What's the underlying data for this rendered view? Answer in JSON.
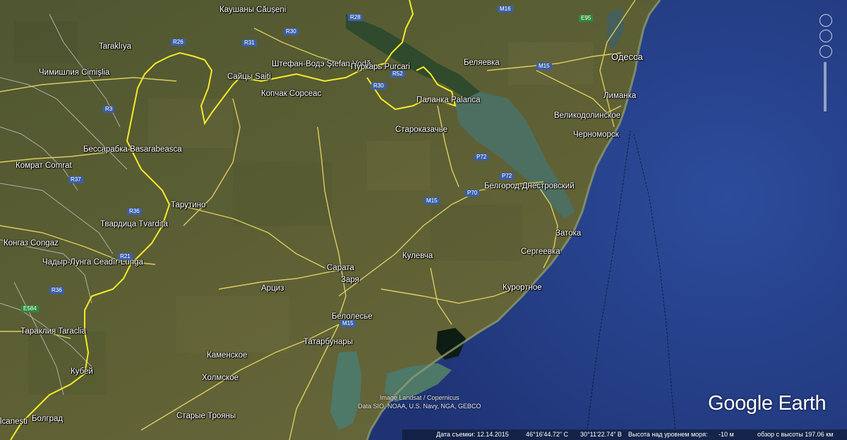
{
  "places": [
    {
      "name": "Каушаны Căușeni",
      "kind": "city"
    },
    {
      "name": "Taraklıya",
      "kind": "city"
    },
    {
      "name": "Чимишлия Cimişlia",
      "kind": "city"
    },
    {
      "name": "Штефан-Водэ Ştefan Vodă",
      "kind": "city"
    },
    {
      "name": "Пуркарь Purcari",
      "kind": "village"
    },
    {
      "name": "Беляевка",
      "kind": "city"
    },
    {
      "name": "Одесса",
      "kind": "major"
    },
    {
      "name": "Сайцы Saiți",
      "kind": "village"
    },
    {
      "name": "Копчак Copceac",
      "kind": "village"
    },
    {
      "name": "Паланка Palanca",
      "kind": "village"
    },
    {
      "name": "Лиманка",
      "kind": "city"
    },
    {
      "name": "Великодолинское",
      "kind": "city"
    },
    {
      "name": "Черноморск",
      "kind": "city"
    },
    {
      "name": "Староказачье",
      "kind": "village"
    },
    {
      "name": "Бессарабка Basarabeasca",
      "kind": "city"
    },
    {
      "name": "Комрат Comrat",
      "kind": "city"
    },
    {
      "name": "Белгород-Днестровский",
      "kind": "city"
    },
    {
      "name": "Тарутино",
      "kind": "village"
    },
    {
      "name": "Твардица Tvardița",
      "kind": "village"
    },
    {
      "name": "Затока",
      "kind": "village"
    },
    {
      "name": "Конгаз Congaz",
      "kind": "village"
    },
    {
      "name": "Сергеевка",
      "kind": "village"
    },
    {
      "name": "Чадыр-Лунга Ceadîr-Lunga",
      "kind": "city"
    },
    {
      "name": "Сарата",
      "kind": "village"
    },
    {
      "name": "Кулевча",
      "kind": "village"
    },
    {
      "name": "Заря",
      "kind": "village"
    },
    {
      "name": "Арциз",
      "kind": "city"
    },
    {
      "name": "Курортное",
      "kind": "village"
    },
    {
      "name": "Белолесье",
      "kind": "village"
    },
    {
      "name": "Тараклия Taraclia",
      "kind": "city"
    },
    {
      "name": "Татарбунары",
      "kind": "city"
    },
    {
      "name": "Каменское",
      "kind": "village"
    },
    {
      "name": "Кубей",
      "kind": "village"
    },
    {
      "name": "Холмское",
      "kind": "village"
    },
    {
      "name": "Старые Трояны",
      "kind": "village"
    },
    {
      "name": "Болград",
      "kind": "city"
    },
    {
      "name": "lcanești",
      "kind": "city"
    }
  ],
  "road_shields": [
    "R28",
    "M16",
    "E95",
    "R30",
    "R26",
    "R31",
    "M15",
    "R52",
    "R30",
    "R3",
    "P72",
    "P72",
    "P70",
    "M15",
    "R37",
    "R36",
    "R36",
    "R21",
    "E584",
    "M15"
  ],
  "attribution": {
    "line1": "Image Landsat / Copernicus",
    "line2": "Data SIO, NOAA, U.S. Navy, NGA, GEBCO"
  },
  "brand": "Google Earth",
  "status_bar": {
    "imagery_date_label": "Дата съемки: 12.14.2015",
    "latitude": "46°16'44.72\" С",
    "longitude": "30°11'22.74\" В",
    "elevation_label": "Высота над уровнем моря:",
    "elevation_value": "-10 м",
    "eye_alt_label": "обзор с высоты 197.06 км"
  },
  "colors": {
    "land": "#5b5f35",
    "sea": "#263f8e",
    "liman": "#4d6f61",
    "roads": "#e9d965",
    "border": "#f2ea2a",
    "admin_lines": "#c9c9d2"
  }
}
